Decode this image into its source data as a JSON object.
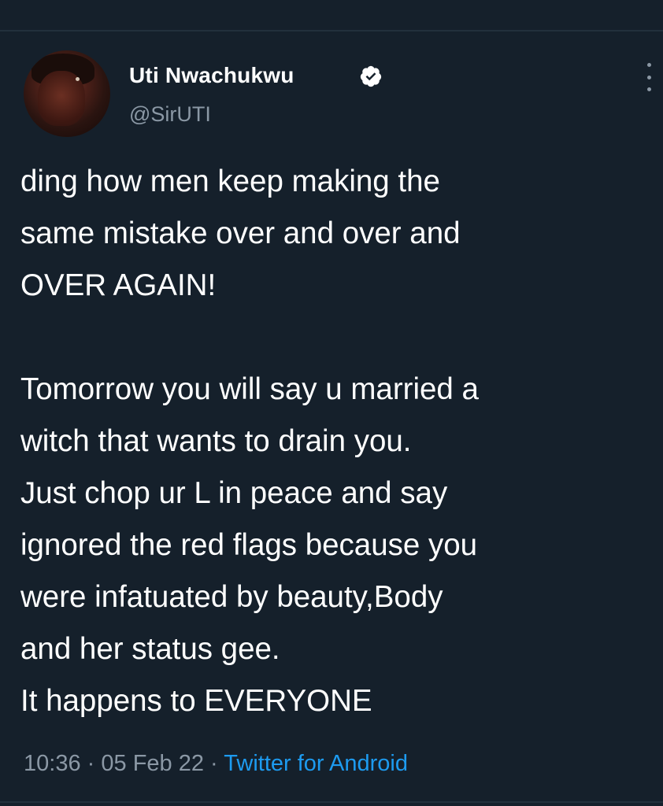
{
  "user": {
    "display_name": "Uti Nwachukwu",
    "handle": "@SirUTI",
    "verified": true,
    "avatar": "profile-photo"
  },
  "tweet": {
    "lines": [
      "ding how men keep making the",
      "same mistake over and over and",
      "OVER AGAIN!",
      "",
      "Tomorrow you will say u married a",
      "witch that wants to drain you.",
      "Just chop ur L in peace and say",
      "ignored the red flags because you",
      "were infatuated by beauty,Body",
      "and her status gee.",
      "It happens to EVERYONE"
    ],
    "time": "10:36",
    "date": "05 Feb 22",
    "separator": "·",
    "source": "Twitter for Android"
  },
  "icons": {
    "verified": "verified-badge-icon",
    "more": "more-options-icon"
  },
  "colors": {
    "background": "#15202b",
    "text": "#ffffff",
    "secondary": "#8b98a5",
    "link": "#1d9bf0"
  }
}
